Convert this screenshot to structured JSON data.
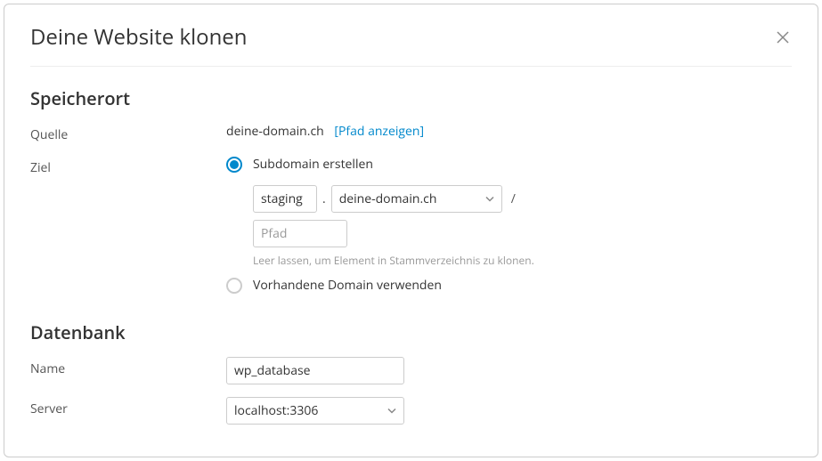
{
  "dialog": {
    "title": "Deine Website klonen"
  },
  "storage": {
    "section_title": "Speicherort",
    "source_label": "Quelle",
    "source_domain": "deine-domain.ch",
    "show_path_link": "[Pfad anzeigen]",
    "target_label": "Ziel",
    "radio_create_subdomain": "Subdomain erstellen",
    "radio_use_existing": "Vorhandene Domain verwenden",
    "subdomain_value": "staging",
    "dot": ".",
    "domain_select_value": "deine-domain.ch",
    "slash": "/",
    "path_placeholder": "Pfad",
    "path_hint": "Leer lassen, um Element in Stammverzeichnis zu klonen."
  },
  "database": {
    "section_title": "Datenbank",
    "name_label": "Name",
    "name_value": "wp_database",
    "server_label": "Server",
    "server_value": "localhost:3306"
  }
}
